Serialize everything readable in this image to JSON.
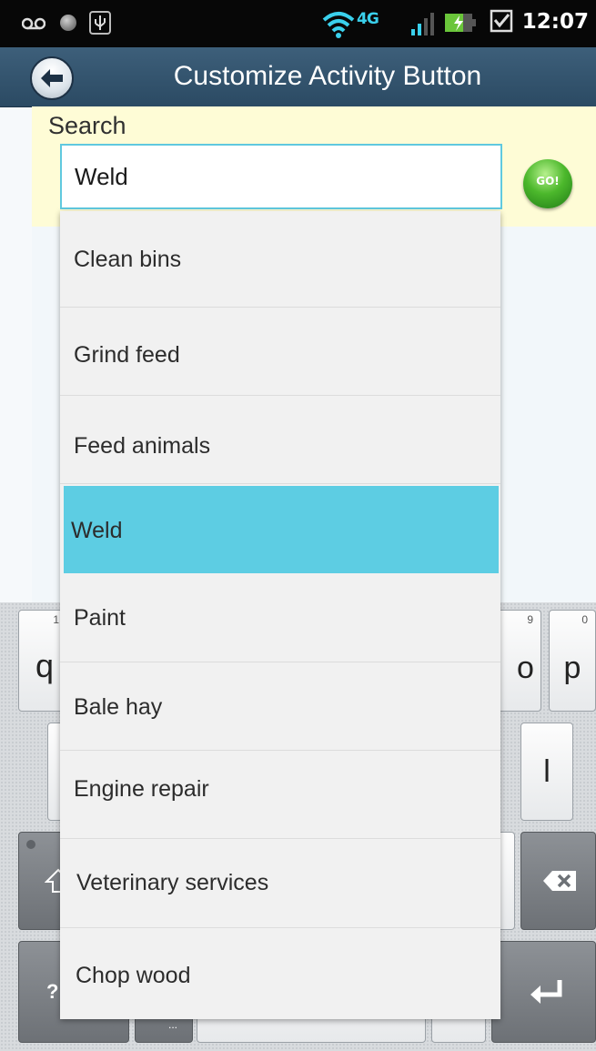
{
  "status_bar": {
    "network": "4G",
    "clock": "12:07",
    "icons": [
      "voicemail-icon",
      "notification-dot-icon",
      "usb-icon",
      "wifi-icon",
      "signal-icon",
      "battery-charging-icon",
      "checkbox-icon"
    ]
  },
  "title_bar": {
    "title": "Customize Activity Button",
    "back_icon": "back-arrow-icon"
  },
  "search": {
    "label": "Search",
    "value": "Weld",
    "go_label": "GO!"
  },
  "dropdown": {
    "items": [
      {
        "label": "Clean bins",
        "selected": false
      },
      {
        "label": "Grind feed",
        "selected": false
      },
      {
        "label": "Feed animals",
        "selected": false
      },
      {
        "label": "Weld",
        "selected": true
      },
      {
        "label": "Paint",
        "selected": false
      },
      {
        "label": "Bale hay",
        "selected": false
      },
      {
        "label": "Engine repair",
        "selected": false
      },
      {
        "label": "Veterinary services",
        "selected": false
      },
      {
        "label": "Chop wood",
        "selected": false
      }
    ]
  },
  "keyboard": {
    "q": "q",
    "q_sub": "1",
    "o": "o",
    "o_sub": "9",
    "p": "p",
    "p_sub": "0",
    "l": "l",
    "question": "?",
    "ellipsis": "..."
  },
  "colors": {
    "highlight": "#5dcde3",
    "title_bar": "#35566f",
    "search_panel": "#fefcd6"
  }
}
